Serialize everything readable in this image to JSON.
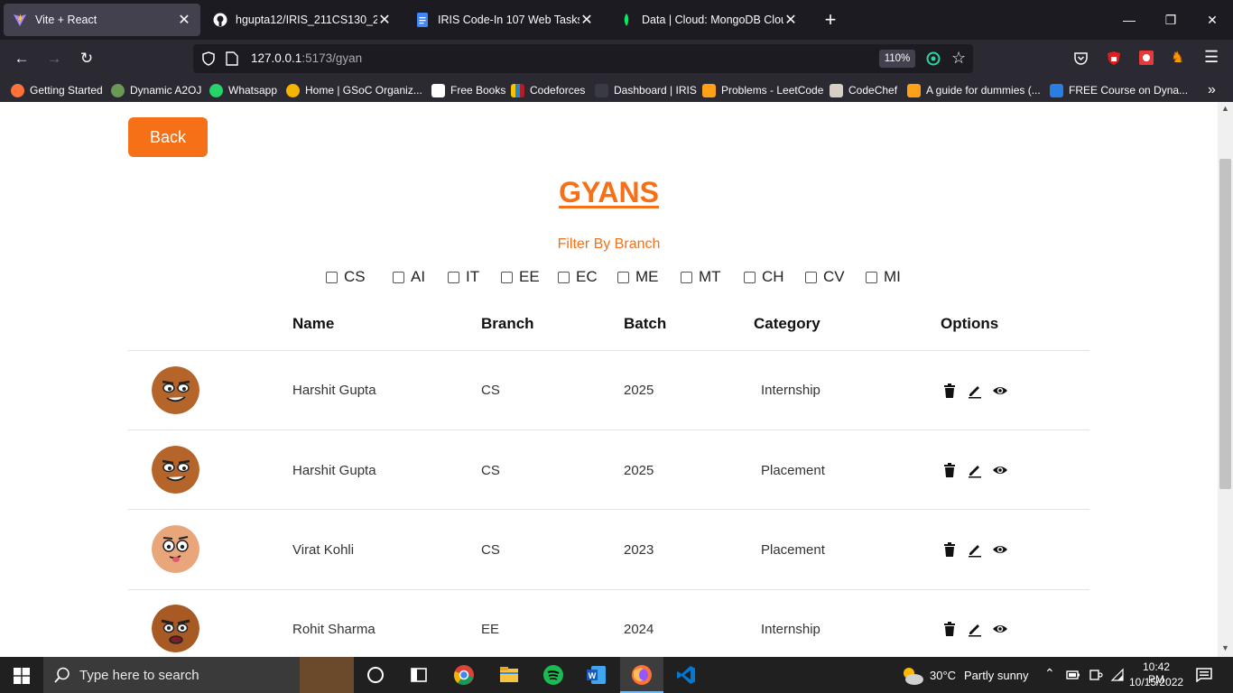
{
  "browser": {
    "tabs": [
      {
        "title": "Vite + React",
        "active": true
      },
      {
        "title": "hgupta12/IRIS_211CS130_2_MER",
        "active": false
      },
      {
        "title": "IRIS Code-In 107 Web Tasks - Go",
        "active": false
      },
      {
        "title": "Data | Cloud: MongoDB Cloud",
        "active": false
      }
    ],
    "url_host": "127.0.0.1",
    "url_rest": ":5173/gyan",
    "zoom": "110%",
    "bookmarks": [
      "Getting Started",
      "Dynamic A2OJ",
      "Whatsapp",
      "Home | GSoC Organiz...",
      "Free Books",
      "Codeforces",
      "Dashboard | IRIS",
      "Problems - LeetCode",
      "CodeChef",
      "A guide for dummies (...",
      "FREE Course on Dyna..."
    ]
  },
  "page": {
    "back_label": "Back",
    "title": "GYANS",
    "filter_label": "Filter By Branch",
    "branches": [
      "CS",
      "AI",
      "IT",
      "EE",
      "EC",
      "ME",
      "MT",
      "CH",
      "CV",
      "MI"
    ],
    "columns": [
      "Name",
      "Branch",
      "Batch",
      "Category",
      "Options"
    ],
    "rows": [
      {
        "name": "Harshit Gupta",
        "branch": "CS",
        "batch": "2025",
        "category": "Internship"
      },
      {
        "name": "Harshit Gupta",
        "branch": "CS",
        "batch": "2025",
        "category": "Placement"
      },
      {
        "name": "Virat Kohli",
        "branch": "CS",
        "batch": "2023",
        "category": "Placement"
      },
      {
        "name": "Rohit Sharma",
        "branch": "EE",
        "batch": "2024",
        "category": "Internship"
      }
    ]
  },
  "taskbar": {
    "search_placeholder": "Type here to search",
    "temperature": "30°C",
    "weather": "Partly sunny",
    "time": "10:42 PM",
    "date": "10/15/2022"
  }
}
